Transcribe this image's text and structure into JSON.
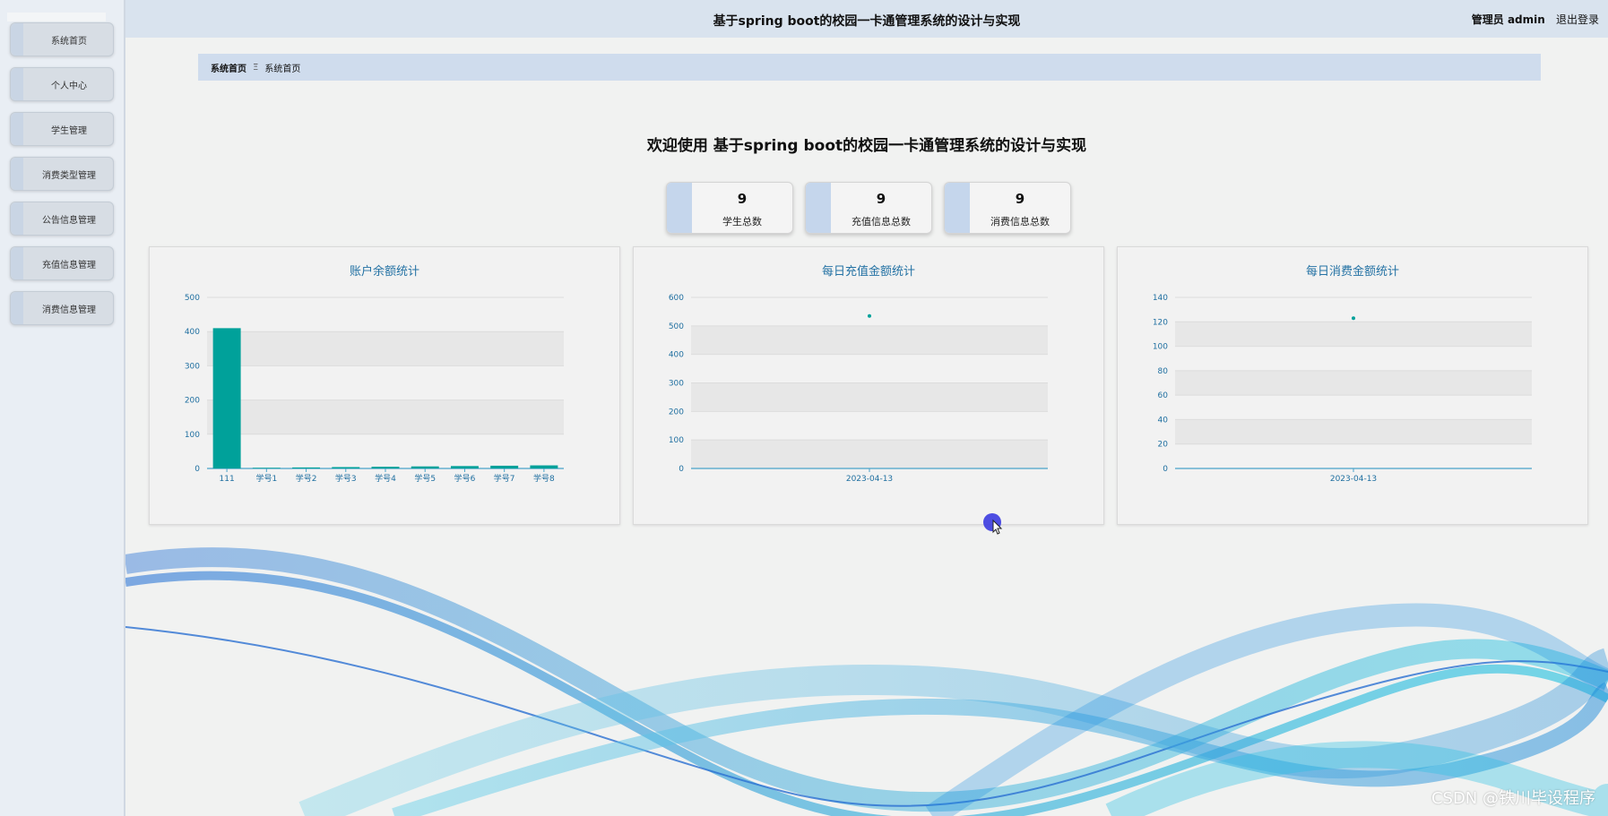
{
  "app": {
    "title": "基于spring boot的校园一卡通管理系统的设计与实现",
    "user_label": "管理员 admin",
    "logout_label": "退出登录"
  },
  "sidebar": {
    "items": [
      {
        "label": "系统首页"
      },
      {
        "label": "个人中心"
      },
      {
        "label": "学生管理"
      },
      {
        "label": "消费类型管理"
      },
      {
        "label": "公告信息管理"
      },
      {
        "label": "充值信息管理"
      },
      {
        "label": "消费信息管理"
      }
    ]
  },
  "breadcrumb": {
    "home": "系统首页",
    "separator": "Ξ",
    "current": "系统首页"
  },
  "welcome": "欢迎使用 基于spring boot的校园一卡通管理系统的设计与实现",
  "stats": [
    {
      "value": "9",
      "label": "学生总数"
    },
    {
      "value": "9",
      "label": "充值信息总数"
    },
    {
      "value": "9",
      "label": "消费信息总数"
    }
  ],
  "colors": {
    "accent": "#00a19a",
    "axis_text": "#1f6fa0",
    "band_shade": "#e7e7e7"
  },
  "chart_data": [
    {
      "type": "bar",
      "title": "账户余额统计",
      "categories": [
        "111",
        "学号1",
        "学号2",
        "学号3",
        "学号4",
        "学号5",
        "学号6",
        "学号7",
        "学号8"
      ],
      "values": [
        410,
        2,
        3,
        4,
        5,
        6,
        7,
        8,
        9
      ],
      "ylim": [
        0,
        500
      ],
      "yticks": [
        0,
        100,
        200,
        300,
        400,
        500
      ]
    },
    {
      "type": "scatter",
      "title": "每日充值金额统计",
      "categories": [
        "2023-04-13"
      ],
      "values": [
        535
      ],
      "ylim": [
        0,
        600
      ],
      "yticks": [
        0,
        100,
        200,
        300,
        400,
        500,
        600
      ]
    },
    {
      "type": "scatter",
      "title": "每日消费金额统计",
      "categories": [
        "2023-04-13"
      ],
      "values": [
        123
      ],
      "ylim": [
        0,
        140
      ],
      "yticks": [
        0,
        20,
        40,
        60,
        80,
        100,
        120,
        140
      ]
    }
  ],
  "watermark": "CSDN @铁川毕设程序"
}
